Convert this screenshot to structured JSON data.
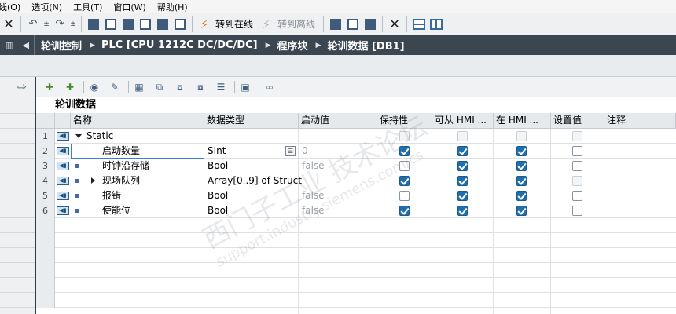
{
  "menu": [
    "线(O)",
    "选项(N)",
    "工具(T)",
    "窗口(W)",
    "帮助(H)"
  ],
  "toolbar": {
    "go_online": "转到在线",
    "go_offline": "转到离线"
  },
  "breadcrumb": [
    "轮训控制",
    "PLC [CPU 1212C DC/DC/DC]",
    "程序块",
    "轮训数据 [DB1]"
  ],
  "block_title": "轮训数据",
  "columns": {
    "name": "名称",
    "datatype": "数据类型",
    "start": "启动值",
    "retain": "保持性",
    "hmi_access": "可从 HMI ...",
    "hmi_visible": "在 HMI ...",
    "setpoint": "设置值",
    "comment": "注释"
  },
  "rows": [
    {
      "num": "1",
      "name": "Static",
      "type": "",
      "start": "",
      "retain": null,
      "access": null,
      "visible": null,
      "setpoint": null
    },
    {
      "num": "2",
      "name": "启动数量",
      "type": "SInt",
      "start": "0",
      "retain": true,
      "access": true,
      "visible": true,
      "setpoint": false
    },
    {
      "num": "3",
      "name": "时钟沿存储",
      "type": "Bool",
      "start": "false",
      "retain": false,
      "access": true,
      "visible": true,
      "setpoint": false
    },
    {
      "num": "4",
      "name": "现场队列",
      "type": "Array[0..9] of Struct",
      "start": "",
      "retain": true,
      "access": true,
      "visible": true,
      "setpoint": null
    },
    {
      "num": "5",
      "name": "报错",
      "type": "Bool",
      "start": "false",
      "retain": false,
      "access": true,
      "visible": true,
      "setpoint": false
    },
    {
      "num": "6",
      "name": "使能位",
      "type": "Bool",
      "start": "false",
      "retain": true,
      "access": true,
      "visible": true,
      "setpoint": false
    }
  ],
  "watermark": "西门子工业 技术论坛",
  "watermark_url": "support.industry.siemens.com/cs",
  "colors": {
    "accent": "#1f6fae",
    "crumb_bg": "#3b4651"
  }
}
